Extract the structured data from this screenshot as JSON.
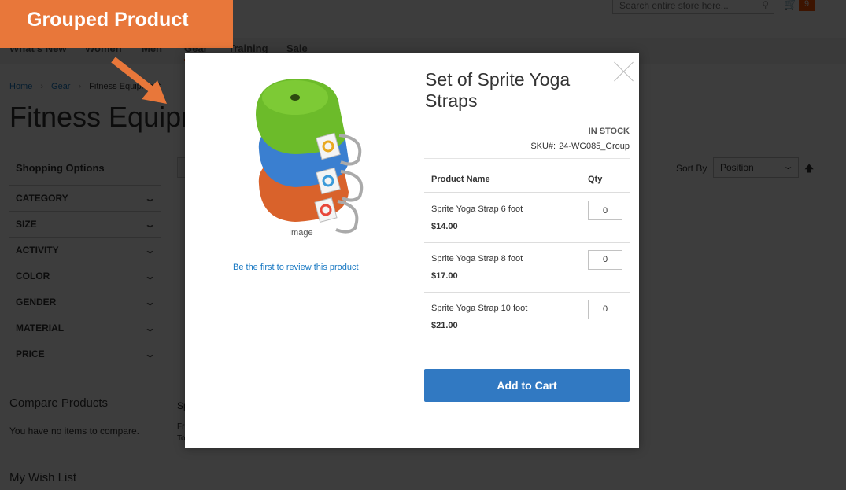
{
  "callout": {
    "label": "Grouped Product",
    "color": "#e8773a"
  },
  "header": {
    "search_placeholder": "Search entire store here...",
    "search_icon": "search-icon",
    "cart_icon": "cart-icon",
    "cart_count": "9"
  },
  "nav": {
    "items": [
      "What's New",
      "Women",
      "Men",
      "Gear",
      "Training",
      "Sale"
    ],
    "active": "Gear"
  },
  "breadcrumb": {
    "items": [
      "Home",
      "Gear",
      "Fitness Equipment"
    ]
  },
  "page_title": "Fitness Equipment",
  "sidebar": {
    "filters_title": "Shopping Options",
    "filters": [
      "Category",
      "Size",
      "Activity",
      "Color",
      "Gender",
      "Material",
      "Price"
    ],
    "compare_title": "Compare Products",
    "compare_text": "You have no items to compare.",
    "wishlist_title": "My Wish List"
  },
  "toolbar": {
    "sort_label": "Sort By",
    "sort_value": "Position"
  },
  "background_partial": {
    "sp": "Sp",
    "fr": "Fr",
    "to": "To"
  },
  "modal": {
    "image_label": "Image",
    "review_link": "Be the first to review this product",
    "title": "Set of Sprite Yoga Straps",
    "stock": "IN STOCK",
    "sku_label": "SKU#:",
    "sku_value": "24-WG085_Group",
    "table": {
      "headers": [
        "Product Name",
        "Qty"
      ],
      "rows": [
        {
          "name": "Sprite Yoga Strap 6 foot",
          "price": "$14.00",
          "qty": "0"
        },
        {
          "name": "Sprite Yoga Strap 8 foot",
          "price": "$17.00",
          "qty": "0"
        },
        {
          "name": "Sprite Yoga Strap 10 foot",
          "price": "$21.00",
          "qty": "0"
        }
      ]
    },
    "add_to_cart": "Add to Cart",
    "button_color": "#3179c2"
  }
}
